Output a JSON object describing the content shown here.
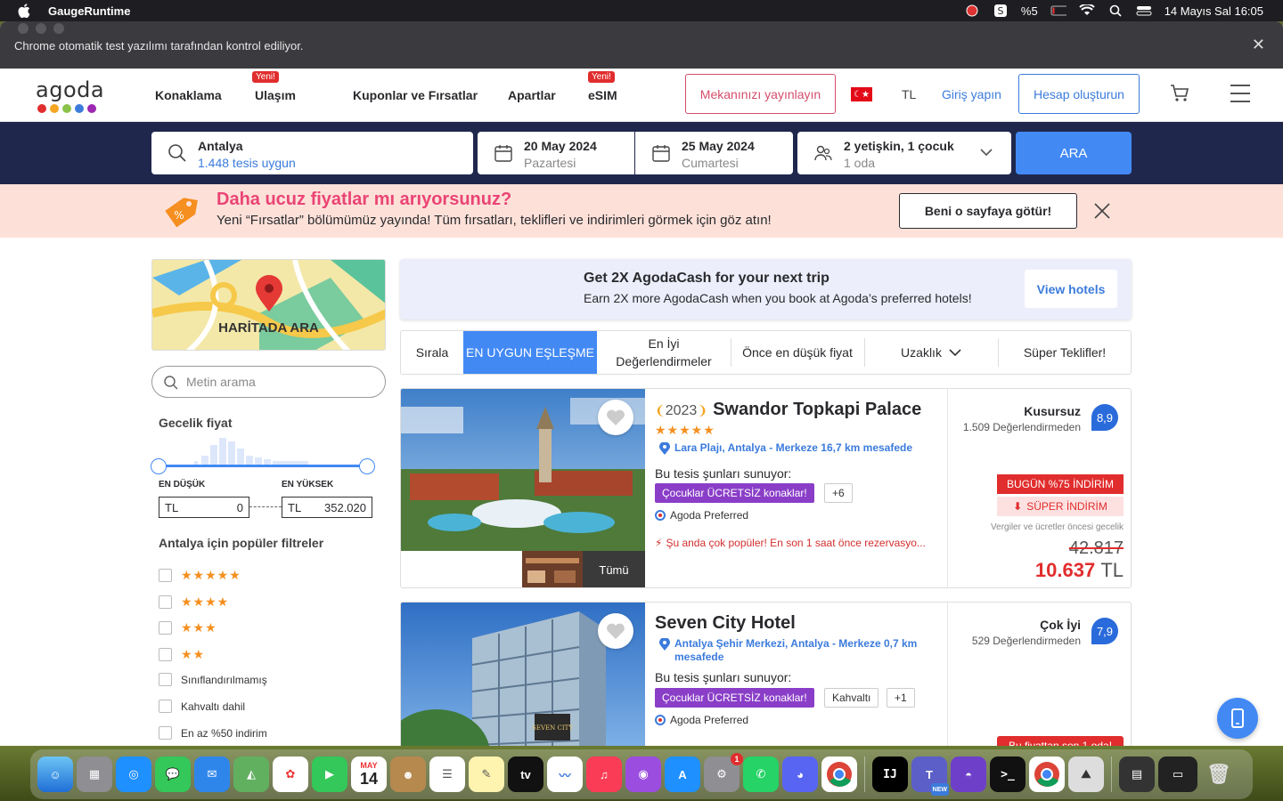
{
  "menubar": {
    "app_name": "GaugeRuntime",
    "battery": "%5",
    "datetime": "14 Mayıs Sal  16:05"
  },
  "infobar": {
    "message": "Chrome otomatik test yazılımı tarafından kontrol ediliyor."
  },
  "header": {
    "logo_text": "agoda",
    "logo_dot_colors": [
      "#e12d2d",
      "#f5a623",
      "#8bc34a",
      "#3b7bdc",
      "#9c27b0"
    ],
    "nav": [
      {
        "label": "Konaklama",
        "new": ""
      },
      {
        "label": "Ulaşım",
        "new": "Yeni!"
      },
      {
        "label": "Kuponlar ve Fırsatlar",
        "new": ""
      },
      {
        "label": "Apartlar",
        "new": ""
      },
      {
        "label": "eSIM",
        "new": "Yeni!"
      }
    ],
    "publish_label": "Mekanınızı yayınlayın",
    "currency": "TL",
    "login_label": "Giriş yapın",
    "signup_label": "Hesap oluşturun"
  },
  "search": {
    "destination": "Antalya",
    "destination_sub": "1.448 tesis uygun",
    "checkin": "20 May 2024",
    "checkin_day": "Pazartesi",
    "checkout": "25 May 2024",
    "checkout_day": "Cumartesi",
    "guests": "2 yetişkin, 1 çocuk",
    "rooms": "1 oda",
    "button": "ARA"
  },
  "promo": {
    "title": "Daha ucuz fiyatlar mı arıyorsunuz?",
    "text": "Yeni “Fırsatlar” bölümümüz yayında! Tüm fırsatları, teklifleri ve indirimleri görmek için göz atın!",
    "button": "Beni o sayfaya götür!"
  },
  "sidebar": {
    "map_label": "HARİTADA ARA",
    "text_search_placeholder": "Metin arama",
    "price_heading": "Gecelik fiyat",
    "min_label": "EN DÜŞÜK",
    "max_label": "EN YÜKSEK",
    "min_currency": "TL",
    "min_value": "0",
    "max_currency": "TL",
    "max_value": "352.020",
    "popular_heading": "Antalya için popüler filtreler",
    "filters": [
      {
        "label": "★★★★★"
      },
      {
        "label": "★★★★"
      },
      {
        "label": "★★★"
      },
      {
        "label": "★★"
      },
      {
        "label": "Sınıflandırılmamış"
      },
      {
        "label": "Kahvaltı dahil"
      },
      {
        "label": "En az %50 indirim"
      }
    ]
  },
  "cash_banner": {
    "title": "Get 2X AgodaCash for your next trip",
    "subtitle": "Earn 2X more AgodaCash when you book at Agoda’s preferred hotels!",
    "button": "View hotels"
  },
  "sort": {
    "label": "Sırala",
    "options": [
      "EN UYGUN EŞLEŞME",
      "En İyi Değerlendirmeler",
      "Önce en düşük fiyat",
      "Uzaklık",
      "Süper Teklifler!"
    ]
  },
  "hotels": [
    {
      "year": "2023",
      "name": "Swandor Topkapi Palace",
      "stars": "★★★★★",
      "location": "Lara Plajı, Antalya - Merkeze 16,7 km mesafede",
      "offers_label": "Bu tesis şunları sunuyor:",
      "chip_main": "Çocuklar ÜCRETSİZ konaklar!",
      "chip_extra": "+6",
      "preferred": "Agoda Preferred",
      "popular": "Şu anda çok popüler! En son 1 saat önce rezervasyo...",
      "all_photos": "Tümü",
      "rating_word": "Kusursuz",
      "rating_count": "1.509 Değerlendirmeden",
      "score": "8,9",
      "discount": "BUGÜN %75 İNDİRİM",
      "super_discount": "SÜPER İNDİRİM",
      "tax_note": "Vergiler ve ücretler öncesi gecelik",
      "old_price": "42.817",
      "new_price": "10.637",
      "currency": "TL"
    },
    {
      "name": "Seven City Hotel",
      "location": "Antalya Şehir Merkezi, Antalya - Merkeze 0,7 km mesafede",
      "offers_label": "Bu tesis şunları sunuyor:",
      "chip_main": "Çocuklar ÜCRETSİZ konaklar!",
      "chip_breakfast": "Kahvaltı",
      "chip_extra": "+1",
      "preferred": "Agoda Preferred",
      "rating_word": "Çok İyi",
      "rating_count": "529 Değerlendirmeden",
      "score": "7,9",
      "last_room": "Bu fiyattan son 1 oda!"
    }
  ],
  "dock": {
    "calendar_month": "MAY",
    "calendar_day": "14",
    "settings_badge": "1",
    "teams_badge": "NEW"
  }
}
